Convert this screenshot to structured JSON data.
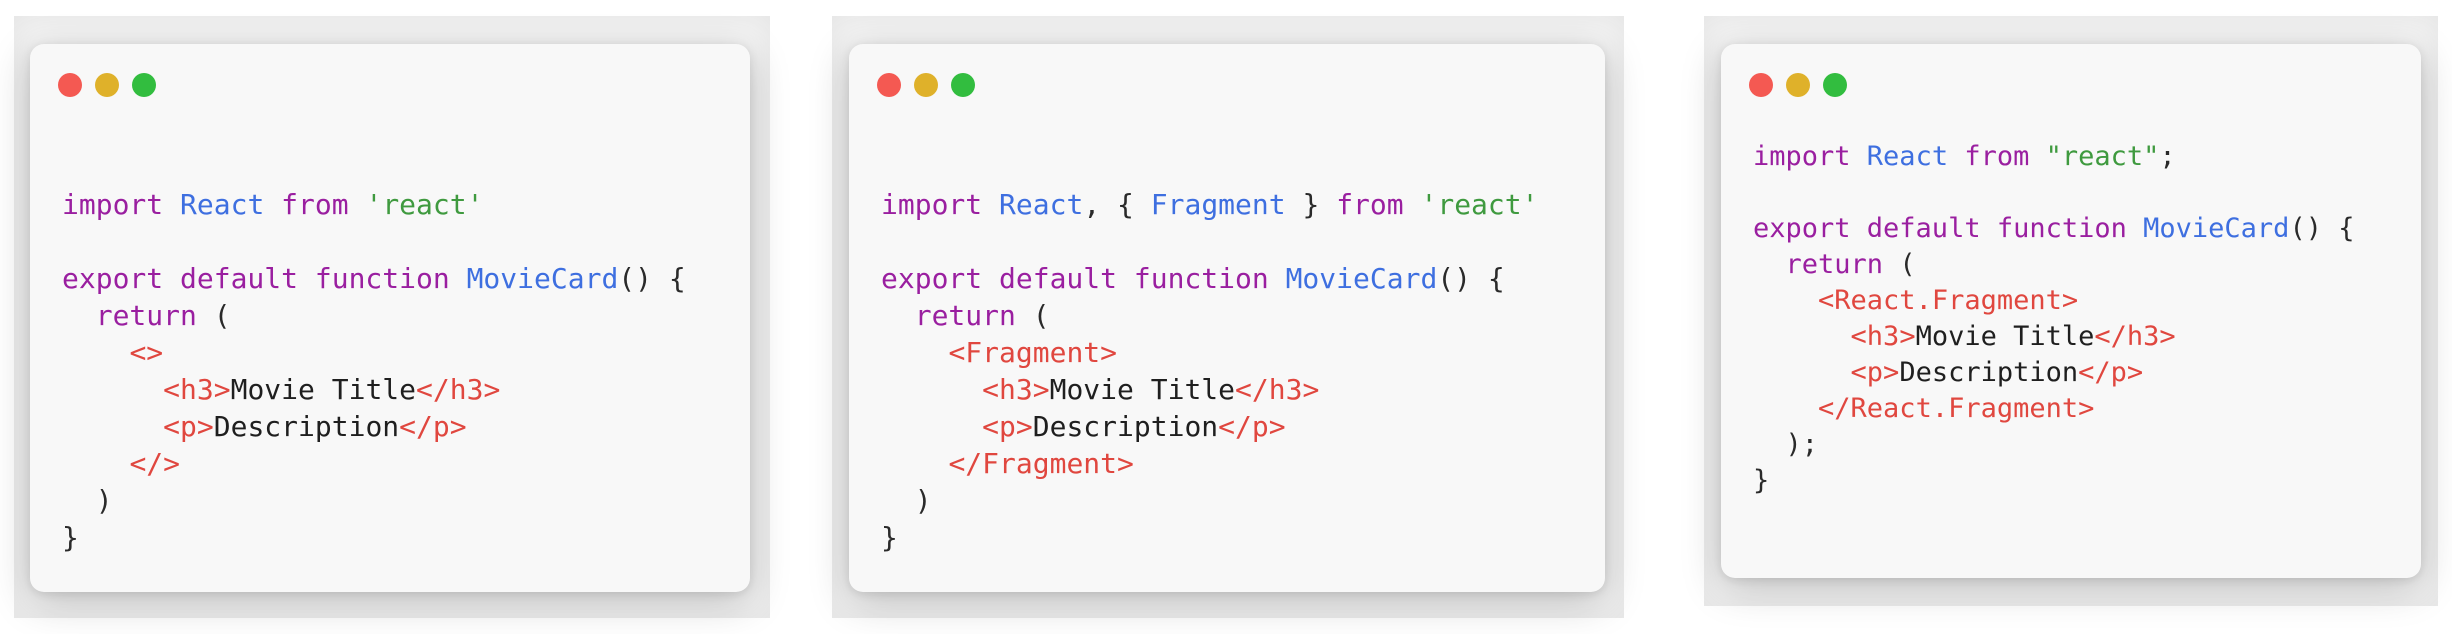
{
  "colors": {
    "keyword": "#9a1fa0",
    "identifier": "#3e6fe0",
    "string": "#3f9a3f",
    "tag": "#e0473f",
    "text": "#1f1f1f",
    "window_bg": "#f8f8f8",
    "dot_red": "#f45952",
    "dot_yellow": "#dfb12a",
    "dot_green": "#32bd3f"
  },
  "window_controls": [
    "close-dot",
    "minimize-dot",
    "maximize-dot"
  ],
  "windows": [
    {
      "lines": [
        [
          {
            "t": "kw",
            "v": "import "
          },
          {
            "t": "id",
            "v": "React "
          },
          {
            "t": "kw",
            "v": "from "
          },
          {
            "t": "str",
            "v": "'react'"
          }
        ],
        [],
        [
          {
            "t": "kw",
            "v": "export default function "
          },
          {
            "t": "id",
            "v": "MovieCard"
          },
          {
            "t": "pun",
            "v": "() {"
          }
        ],
        [
          {
            "t": "pun",
            "v": "  "
          },
          {
            "t": "kw",
            "v": "return "
          },
          {
            "t": "pun",
            "v": "("
          }
        ],
        [
          {
            "t": "pun",
            "v": "    "
          },
          {
            "t": "tag",
            "v": "<>"
          }
        ],
        [
          {
            "t": "pun",
            "v": "      "
          },
          {
            "t": "tag",
            "v": "<h3>"
          },
          {
            "t": "txt",
            "v": "Movie Title"
          },
          {
            "t": "tag",
            "v": "</h3>"
          }
        ],
        [
          {
            "t": "pun",
            "v": "      "
          },
          {
            "t": "tag",
            "v": "<p>"
          },
          {
            "t": "txt",
            "v": "Description"
          },
          {
            "t": "tag",
            "v": "</p>"
          }
        ],
        [
          {
            "t": "pun",
            "v": "    "
          },
          {
            "t": "tag",
            "v": "</>"
          }
        ],
        [
          {
            "t": "pun",
            "v": "  )"
          }
        ],
        [
          {
            "t": "pun",
            "v": "}"
          }
        ]
      ]
    },
    {
      "lines": [
        [
          {
            "t": "kw",
            "v": "import "
          },
          {
            "t": "id",
            "v": "React"
          },
          {
            "t": "pun",
            "v": ", { "
          },
          {
            "t": "id",
            "v": "Fragment"
          },
          {
            "t": "pun",
            "v": " } "
          },
          {
            "t": "kw",
            "v": "from "
          },
          {
            "t": "str",
            "v": "'react'"
          }
        ],
        [],
        [
          {
            "t": "kw",
            "v": "export default function "
          },
          {
            "t": "id",
            "v": "MovieCard"
          },
          {
            "t": "pun",
            "v": "() {"
          }
        ],
        [
          {
            "t": "pun",
            "v": "  "
          },
          {
            "t": "kw",
            "v": "return "
          },
          {
            "t": "pun",
            "v": "("
          }
        ],
        [
          {
            "t": "pun",
            "v": "    "
          },
          {
            "t": "tag",
            "v": "<Fragment>"
          }
        ],
        [
          {
            "t": "pun",
            "v": "      "
          },
          {
            "t": "tag",
            "v": "<h3>"
          },
          {
            "t": "txt",
            "v": "Movie Title"
          },
          {
            "t": "tag",
            "v": "</h3>"
          }
        ],
        [
          {
            "t": "pun",
            "v": "      "
          },
          {
            "t": "tag",
            "v": "<p>"
          },
          {
            "t": "txt",
            "v": "Description"
          },
          {
            "t": "tag",
            "v": "</p>"
          }
        ],
        [
          {
            "t": "pun",
            "v": "    "
          },
          {
            "t": "tag",
            "v": "</Fragment>"
          }
        ],
        [
          {
            "t": "pun",
            "v": "  )"
          }
        ],
        [
          {
            "t": "pun",
            "v": "}"
          }
        ]
      ]
    },
    {
      "lines": [
        [
          {
            "t": "kw",
            "v": "import "
          },
          {
            "t": "id",
            "v": "React "
          },
          {
            "t": "kw",
            "v": "from "
          },
          {
            "t": "str",
            "v": "\"react\""
          },
          {
            "t": "pun",
            "v": ";"
          }
        ],
        [],
        [
          {
            "t": "kw",
            "v": "export default function "
          },
          {
            "t": "id",
            "v": "MovieCard"
          },
          {
            "t": "pun",
            "v": "() {"
          }
        ],
        [
          {
            "t": "pun",
            "v": "  "
          },
          {
            "t": "kw",
            "v": "return "
          },
          {
            "t": "pun",
            "v": "("
          }
        ],
        [
          {
            "t": "pun",
            "v": "    "
          },
          {
            "t": "tag",
            "v": "<React.Fragment>"
          }
        ],
        [
          {
            "t": "pun",
            "v": "      "
          },
          {
            "t": "tag",
            "v": "<h3>"
          },
          {
            "t": "txt",
            "v": "Movie Title"
          },
          {
            "t": "tag",
            "v": "</h3>"
          }
        ],
        [
          {
            "t": "pun",
            "v": "      "
          },
          {
            "t": "tag",
            "v": "<p>"
          },
          {
            "t": "txt",
            "v": "Description"
          },
          {
            "t": "tag",
            "v": "</p>"
          }
        ],
        [
          {
            "t": "pun",
            "v": "    "
          },
          {
            "t": "tag",
            "v": "</React.Fragment>"
          }
        ],
        [
          {
            "t": "pun",
            "v": "  );"
          }
        ],
        [
          {
            "t": "pun",
            "v": "}"
          }
        ]
      ]
    }
  ]
}
